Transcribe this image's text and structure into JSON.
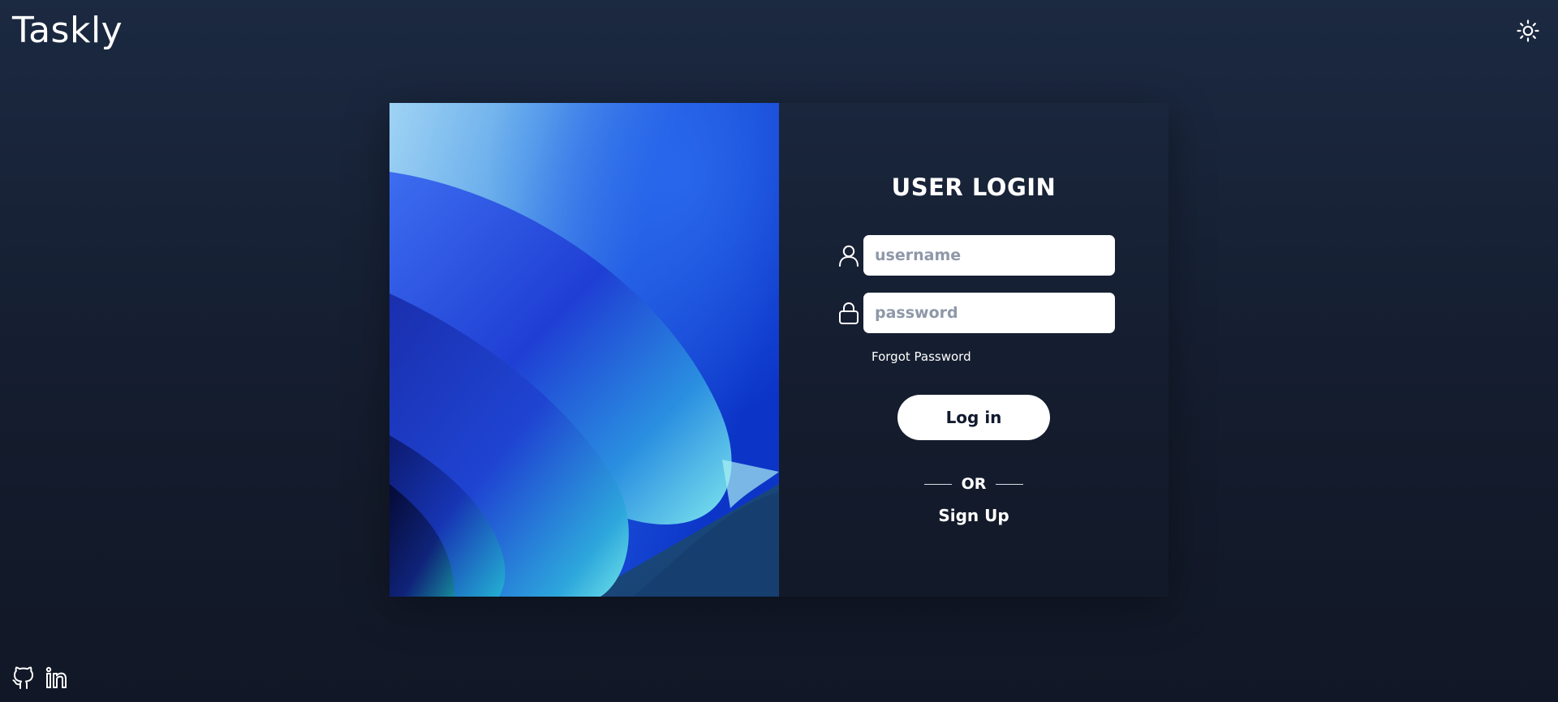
{
  "app": {
    "title": "Taskly"
  },
  "header": {
    "theme_toggle_icon": "sun-icon"
  },
  "login": {
    "heading": "USER LOGIN",
    "username_placeholder": "username",
    "username_value": "",
    "password_placeholder": "password",
    "password_value": "",
    "forgot_password_label": "Forgot Password",
    "login_button_label": "Log in",
    "divider_text": "OR",
    "signup_label": "Sign Up",
    "username_icon": "user-icon",
    "password_icon": "lock-icon"
  },
  "footer": {
    "icons": [
      "github-icon",
      "linkedin-icon"
    ]
  },
  "colors": {
    "background_top": "#1b2941",
    "background_bottom": "#111726",
    "text": "#ffffff",
    "input_background": "#ffffff",
    "placeholder": "#8e98a8",
    "button_background": "#ffffff",
    "button_text": "#111a2e"
  }
}
